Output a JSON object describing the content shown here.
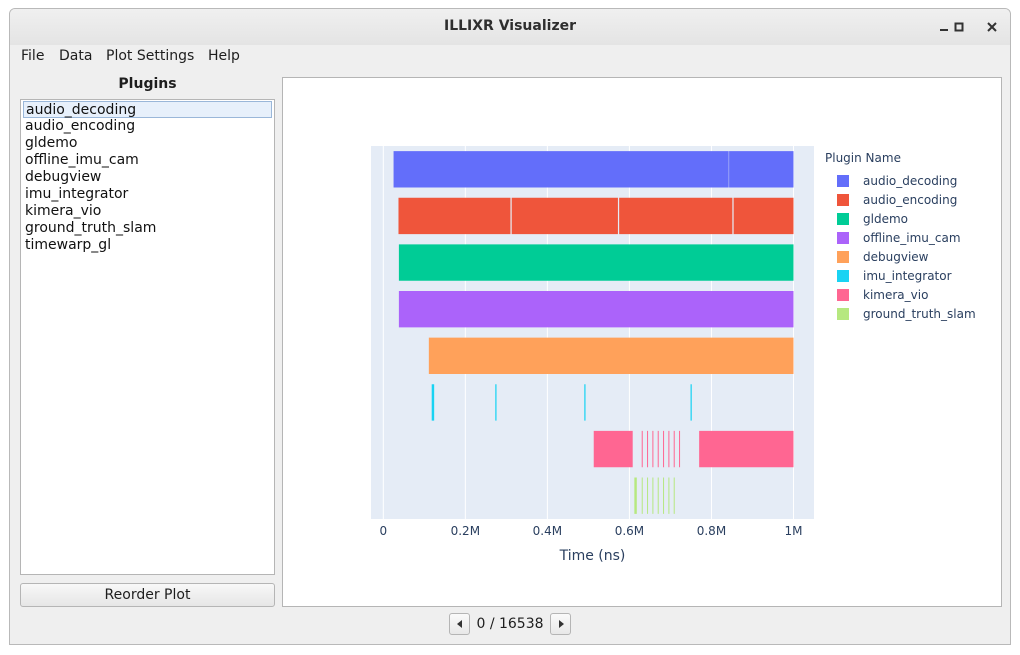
{
  "window": {
    "title": "ILLIXR Visualizer"
  },
  "menu": [
    "File",
    "Data",
    "Plot Settings",
    "Help"
  ],
  "sidebar": {
    "title": "Plugins",
    "selected": 0,
    "items": [
      "audio_decoding",
      "audio_encoding",
      "gldemo",
      "offline_imu_cam",
      "debugview",
      "imu_integrator",
      "kimera_vio",
      "ground_truth_slam",
      "timewarp_gl"
    ],
    "reorder_label": "Reorder Plot"
  },
  "pager": {
    "label": "0 / 16538"
  },
  "colors": {
    "plot_bg": "#e5ecf6",
    "grid": "#ffffff"
  },
  "chart_data": {
    "type": "timeline",
    "xlabel": "Time (ns)",
    "x_ticks": [
      0,
      200000,
      400000,
      600000,
      800000,
      1000000
    ],
    "x_tick_labels": [
      "0",
      "0.2M",
      "0.4M",
      "0.6M",
      "0.8M",
      "1M"
    ],
    "xlim": [
      -30000,
      1050000
    ],
    "legend_title": "Plugin Name",
    "legend_position": "right",
    "series": [
      {
        "name": "audio_decoding",
        "color": "#636efa",
        "segments": [
          [
            25000,
            842000
          ],
          [
            843000,
            1000000
          ]
        ]
      },
      {
        "name": "audio_encoding",
        "color": "#ef553b",
        "segments": [
          [
            37000,
            310000
          ],
          [
            313000,
            572000
          ],
          [
            575000,
            851000
          ],
          [
            854000,
            1000000
          ]
        ]
      },
      {
        "name": "gldemo",
        "color": "#00cc96",
        "segments": [
          [
            38000,
            1000000
          ]
        ]
      },
      {
        "name": "offline_imu_cam",
        "color": "#ab63fa",
        "segments": [
          [
            38000,
            1000000
          ]
        ]
      },
      {
        "name": "debugview",
        "color": "#ffa15a",
        "segments": [
          [
            111000,
            1000000
          ]
        ]
      },
      {
        "name": "imu_integrator",
        "color": "#19d3f3",
        "segments": [
          [
            118000,
            124000
          ],
          [
            273000,
            276000
          ],
          [
            490000,
            493000
          ],
          [
            749000,
            752000
          ]
        ]
      },
      {
        "name": "kimera_vio",
        "color": "#ff6692",
        "segments": [
          [
            513000,
            608000
          ],
          [
            630000,
            632000
          ],
          [
            643000,
            645000
          ],
          [
            656000,
            658000
          ],
          [
            669000,
            671000
          ],
          [
            682000,
            684000
          ],
          [
            695000,
            697000
          ],
          [
            708000,
            710000
          ],
          [
            721000,
            723000
          ],
          [
            770000,
            1000000
          ]
        ]
      },
      {
        "name": "ground_truth_slam",
        "color": "#b6e880",
        "segments": [
          [
            612000,
            618000
          ],
          [
            630000,
            632000
          ],
          [
            643000,
            645000
          ],
          [
            656000,
            658000
          ],
          [
            669000,
            671000
          ],
          [
            682000,
            684000
          ],
          [
            695000,
            697000
          ],
          [
            708000,
            710000
          ]
        ]
      }
    ]
  }
}
